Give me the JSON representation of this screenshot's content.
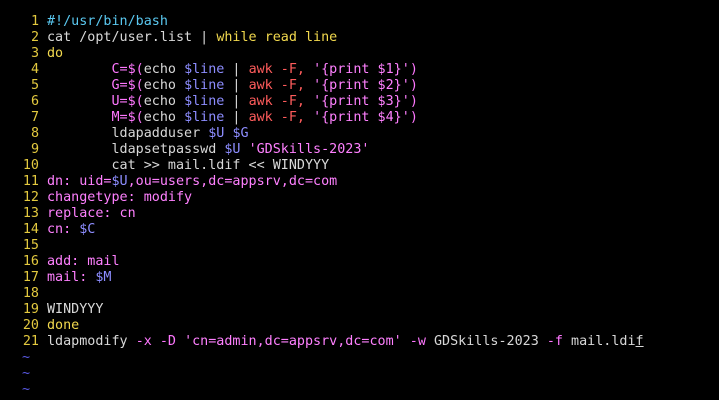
{
  "editor": {
    "colors": {
      "background": "#000000",
      "line_number": "#e3c93f",
      "default": "#d8d8d8",
      "comment": "#5ac8f0",
      "keyword": "#f2d94e",
      "statement": "#ff77ff",
      "variable": "#8d8dff",
      "pipe_command": "#ff5c5c",
      "string": "#ff80ff",
      "tilde": "#5a5ae6"
    },
    "lines": [
      {
        "num": "1",
        "tokens": [
          {
            "t": "#!/usr/bin/bash",
            "c": "#5ac8f0"
          }
        ]
      },
      {
        "num": "2",
        "tokens": [
          {
            "t": "cat /opt/user.list | ",
            "c": "#d8d8d8"
          },
          {
            "t": "while",
            "c": "#f2d94e"
          },
          {
            "t": " ",
            "c": "#d8d8d8"
          },
          {
            "t": "read",
            "c": "#f2d94e"
          },
          {
            "t": " line",
            "c": "#f2d94e"
          }
        ]
      },
      {
        "num": "3",
        "tokens": [
          {
            "t": "do",
            "c": "#f2d94e"
          }
        ]
      },
      {
        "num": "4",
        "tokens": [
          {
            "t": "        C=",
            "c": "#ff77ff"
          },
          {
            "t": "$(",
            "c": "#ff77ff"
          },
          {
            "t": "echo ",
            "c": "#d8d8d8"
          },
          {
            "t": "$line",
            "c": "#8d8dff"
          },
          {
            "t": " | ",
            "c": "#d8d8d8"
          },
          {
            "t": "awk -F, ",
            "c": "#ff5c5c"
          },
          {
            "t": "'{print $1}'",
            "c": "#ff80ff"
          },
          {
            "t": ")",
            "c": "#ff77ff"
          }
        ]
      },
      {
        "num": "5",
        "tokens": [
          {
            "t": "        G=",
            "c": "#ff77ff"
          },
          {
            "t": "$(",
            "c": "#ff77ff"
          },
          {
            "t": "echo ",
            "c": "#d8d8d8"
          },
          {
            "t": "$line",
            "c": "#8d8dff"
          },
          {
            "t": " | ",
            "c": "#d8d8d8"
          },
          {
            "t": "awk -F, ",
            "c": "#ff5c5c"
          },
          {
            "t": "'{print $2}'",
            "c": "#ff80ff"
          },
          {
            "t": ")",
            "c": "#ff77ff"
          }
        ]
      },
      {
        "num": "6",
        "tokens": [
          {
            "t": "        U=",
            "c": "#ff77ff"
          },
          {
            "t": "$(",
            "c": "#ff77ff"
          },
          {
            "t": "echo ",
            "c": "#d8d8d8"
          },
          {
            "t": "$line",
            "c": "#8d8dff"
          },
          {
            "t": " | ",
            "c": "#d8d8d8"
          },
          {
            "t": "awk -F, ",
            "c": "#ff5c5c"
          },
          {
            "t": "'{print $3}'",
            "c": "#ff80ff"
          },
          {
            "t": ")",
            "c": "#ff77ff"
          }
        ]
      },
      {
        "num": "7",
        "tokens": [
          {
            "t": "        M=",
            "c": "#ff77ff"
          },
          {
            "t": "$(",
            "c": "#ff77ff"
          },
          {
            "t": "echo ",
            "c": "#d8d8d8"
          },
          {
            "t": "$line",
            "c": "#8d8dff"
          },
          {
            "t": " | ",
            "c": "#d8d8d8"
          },
          {
            "t": "awk -F, ",
            "c": "#ff5c5c"
          },
          {
            "t": "'{print $4}'",
            "c": "#ff80ff"
          },
          {
            "t": ")",
            "c": "#ff77ff"
          }
        ]
      },
      {
        "num": "8",
        "tokens": [
          {
            "t": "        ldapadduser ",
            "c": "#d8d8d8"
          },
          {
            "t": "$U",
            "c": "#8d8dff"
          },
          {
            "t": " ",
            "c": "#d8d8d8"
          },
          {
            "t": "$G",
            "c": "#8d8dff"
          }
        ]
      },
      {
        "num": "9",
        "tokens": [
          {
            "t": "        ldapsetpasswd ",
            "c": "#d8d8d8"
          },
          {
            "t": "$U",
            "c": "#8d8dff"
          },
          {
            "t": " ",
            "c": "#d8d8d8"
          },
          {
            "t": "'GDSkills-2023'",
            "c": "#ff80ff"
          }
        ]
      },
      {
        "num": "10",
        "tokens": [
          {
            "t": "        cat >> mail.ldif << WINDYYY",
            "c": "#d8d8d8"
          }
        ]
      },
      {
        "num": "11",
        "tokens": [
          {
            "t": "dn: uid=",
            "c": "#ff80ff"
          },
          {
            "t": "$U",
            "c": "#8d8dff"
          },
          {
            "t": ",ou=users,dc=appsrv,dc=com",
            "c": "#ff80ff"
          }
        ]
      },
      {
        "num": "12",
        "tokens": [
          {
            "t": "changetype: modify",
            "c": "#ff80ff"
          }
        ]
      },
      {
        "num": "13",
        "tokens": [
          {
            "t": "replace: cn",
            "c": "#ff80ff"
          }
        ]
      },
      {
        "num": "14",
        "tokens": [
          {
            "t": "cn: ",
            "c": "#ff80ff"
          },
          {
            "t": "$C",
            "c": "#8d8dff"
          }
        ]
      },
      {
        "num": "15",
        "tokens": []
      },
      {
        "num": "16",
        "tokens": [
          {
            "t": "add: mail",
            "c": "#ff80ff"
          }
        ]
      },
      {
        "num": "17",
        "tokens": [
          {
            "t": "mail: ",
            "c": "#ff80ff"
          },
          {
            "t": "$M",
            "c": "#8d8dff"
          }
        ]
      },
      {
        "num": "18",
        "tokens": []
      },
      {
        "num": "19",
        "tokens": [
          {
            "t": "WINDYYY",
            "c": "#d8d8d8"
          }
        ]
      },
      {
        "num": "20",
        "tokens": [
          {
            "t": "done",
            "c": "#f2d94e"
          }
        ]
      },
      {
        "num": "21",
        "tokens": [
          {
            "t": "ldapmodify ",
            "c": "#d8d8d8"
          },
          {
            "t": "-x -D ",
            "c": "#ff77ff"
          },
          {
            "t": "'cn=admin,dc=appsrv,dc=com'",
            "c": "#ff80ff"
          },
          {
            "t": " -w ",
            "c": "#ff77ff"
          },
          {
            "t": "GDSkills-2023 ",
            "c": "#d8d8d8"
          },
          {
            "t": "-f ",
            "c": "#ff77ff"
          },
          {
            "t": "mail.ldi",
            "c": "#d8d8d8"
          },
          {
            "t": "f",
            "c": "#d8d8d8",
            "cursor": true
          }
        ]
      }
    ],
    "tildes": [
      "~",
      "~",
      "~"
    ]
  }
}
